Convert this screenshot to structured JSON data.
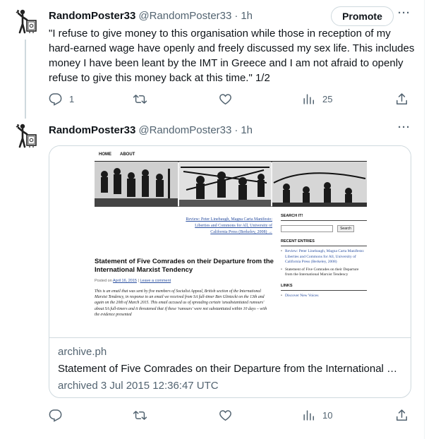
{
  "tweets": [
    {
      "display_name": "RandomPoster33",
      "handle": "@RandomPoster33",
      "sep": "·",
      "time": "1h",
      "promote_label": "Promote",
      "more_label": "···",
      "text": "\"I refuse to give money to this organisation while those in reception of my hard-earned wage have openly and freely discussed my sex life. This includes money I have been leant by the IMT in Greece and I am not afraid to openly refuse to give this money back at this time.\" 1/2",
      "actions": {
        "reply_count": "1",
        "retweet_count": "",
        "like_count": "",
        "views_count": "25"
      }
    },
    {
      "display_name": "RandomPoster33",
      "handle": "@RandomPoster33",
      "sep": "·",
      "time": "1h",
      "more_label": "···",
      "card": {
        "domain": "archive.ph",
        "title": "Statement of Five Comrades on their Departure from the International Marxist Tendency",
        "description": "archived 3 Jul 2015 12:36:47 UTC",
        "page": {
          "nav": [
            "HOME",
            "ABOUT"
          ],
          "review_link": "Review: Peter Linebaugh, Magna Carta Manifesto: Liberties and Commons for All, University of California Press (Berkeley, 2008) →",
          "article_title": "Statement of Five Comrades on their Departure from the International Marxist Tendency",
          "posted_prefix": "Posted on",
          "posted_date": "April 16, 2015",
          "posted_sep": "|",
          "posted_comment": "Leave a comment",
          "body": "This is an email that was sent by five members of Socialist Appeal, British section of the International Marxist Tendency, in response to an email we received from SA full-timer Ben Gliniecki on the 13th and again on the 20th of March 2015. This email accused us of spreading certain 'unsubstantiated rumours' about SA full-timers and it threatened that if these 'rumours' were not substantiated within 10 days – with the evidence presented",
          "search_heading": "SEARCH IT!",
          "search_button": "Search",
          "recent_heading": "RECENT ENTRIES",
          "recent": [
            "Review: Peter Linebaugh, Magna Carta Manifesto: Liberties and Commons for All, University of California Press (Berkeley, 2008)",
            "Statement of Five Comrades on their Departure from the International Marxist Tendency"
          ],
          "links_heading": "LINKS",
          "links": [
            "Discover New Voices"
          ]
        }
      },
      "actions": {
        "reply_count": "",
        "retweet_count": "",
        "like_count": "",
        "views_count": "10"
      }
    }
  ],
  "icons": {
    "avatar": "figure-with-safe-icon",
    "reply": "reply-icon",
    "retweet": "retweet-icon",
    "like": "heart-icon",
    "views": "views-bar-chart-icon",
    "share": "share-icon"
  },
  "colors": {
    "text": "#0f1419",
    "muted": "#536471",
    "border": "#cfd9de",
    "link": "#2a4fa0"
  }
}
